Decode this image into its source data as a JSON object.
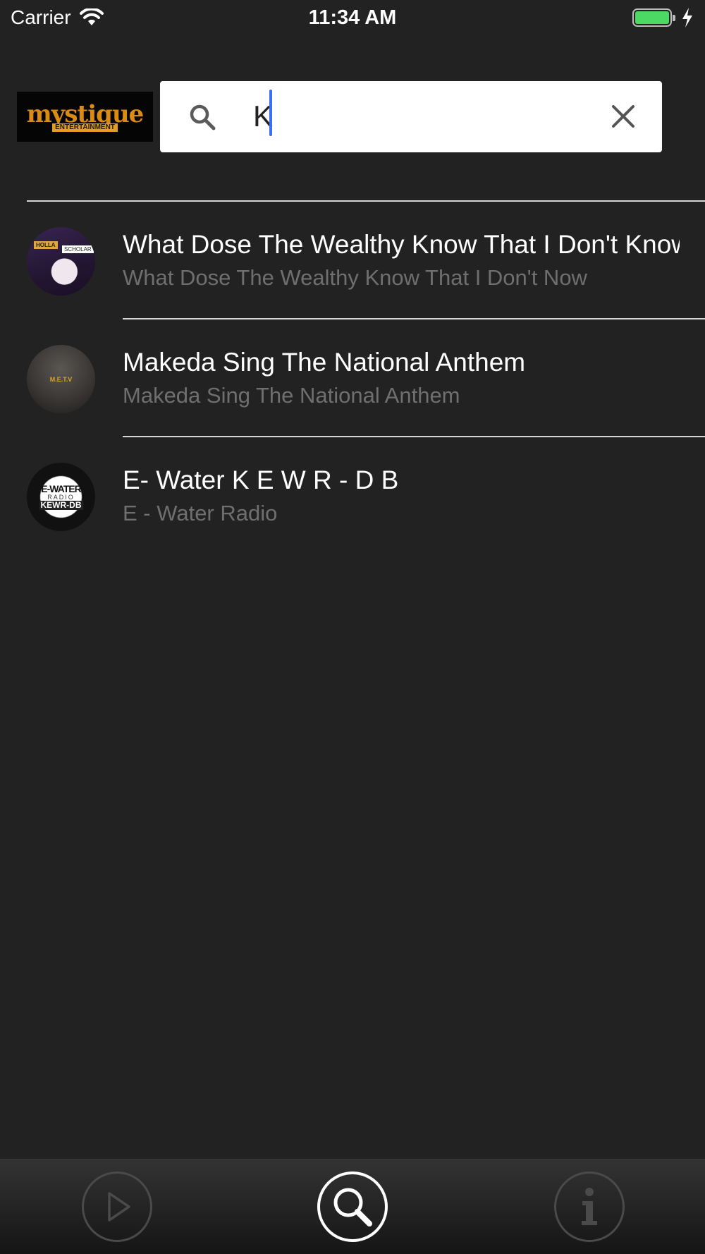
{
  "status_bar": {
    "carrier": "Carrier",
    "time": "11:34 AM"
  },
  "header": {
    "logo_text": "mystique",
    "logo_subtext": "ENTERTAINMENT",
    "search": {
      "value": "K",
      "placeholder": ""
    }
  },
  "results": [
    {
      "title": "What Dose The Wealthy Know That I Don't Know",
      "subtitle": "What Dose The Wealthy Know That I Don't Now",
      "avatar_tag1": "HOLLA",
      "avatar_tag2": "SCHOLAR"
    },
    {
      "title": "Makeda Sing The National Anthem",
      "subtitle": "Makeda Sing The National Anthem",
      "avatar_text": "M.E.T.V"
    },
    {
      "title": "E- Water K E W R - D B",
      "subtitle": "E - Water Radio",
      "avatar_line1": "E-WATER",
      "avatar_line2": "RADIO",
      "avatar_line3": "KEWR-DB"
    }
  ],
  "tab_bar": {
    "tabs": [
      {
        "name": "play",
        "icon": "play-icon",
        "active": false
      },
      {
        "name": "search",
        "icon": "search-icon",
        "active": true
      },
      {
        "name": "info",
        "icon": "info-icon",
        "active": false
      }
    ]
  },
  "colors": {
    "background": "#222222",
    "accent_caret": "#3b6ef0",
    "battery_fill": "#4cd964",
    "subtitle_text": "#6f6f6f"
  }
}
